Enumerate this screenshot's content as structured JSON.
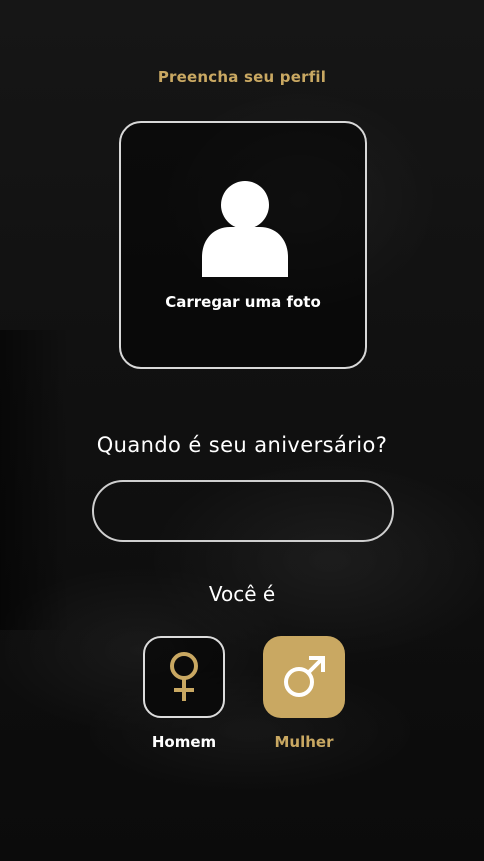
{
  "header": {
    "title": "Preencha seu perfil"
  },
  "photo": {
    "label": "Carregar uma foto",
    "icon": "user-avatar-icon"
  },
  "birthday": {
    "label": "Quando é seu aniversário?",
    "value": "",
    "placeholder": ""
  },
  "gender": {
    "label": "Você é",
    "options": [
      {
        "label": "Homem",
        "icon": "female-symbol-icon",
        "selected": false
      },
      {
        "label": "Mulher",
        "icon": "male-symbol-icon",
        "selected": true
      }
    ]
  },
  "colors": {
    "accent": "#c9a862",
    "background": "#111111",
    "text": "#ffffff",
    "border": "#d8d8d8"
  }
}
